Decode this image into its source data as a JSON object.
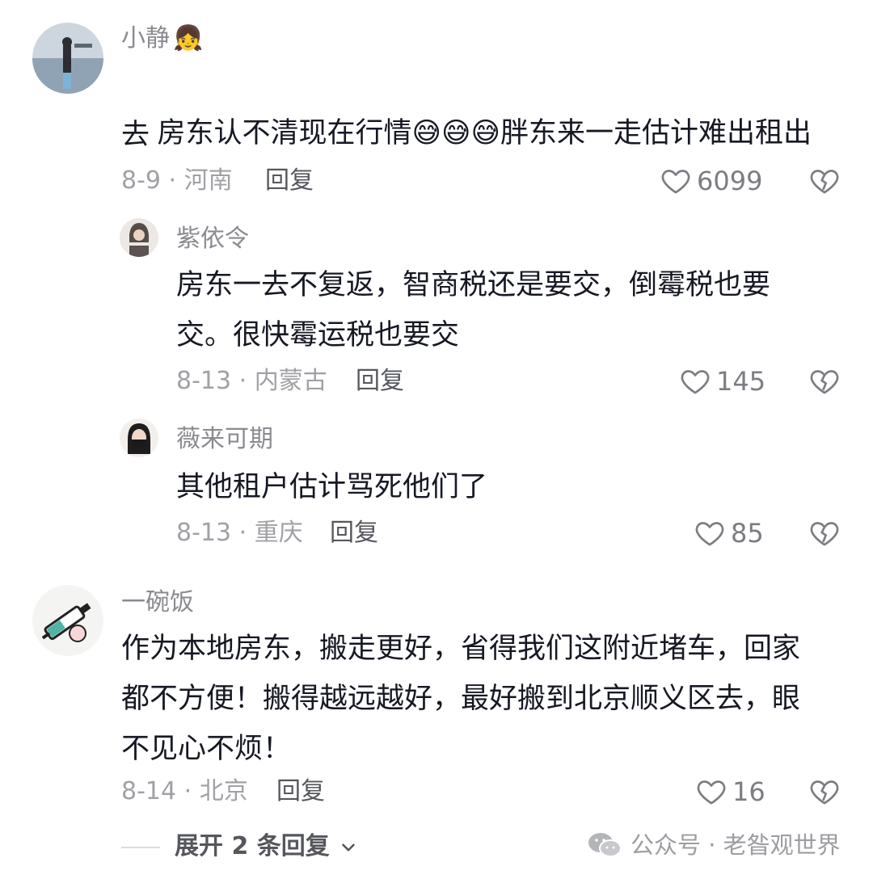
{
  "comments": [
    {
      "username": "小静",
      "username_emoji": "👧",
      "text_part1": "房东认不清现在行情",
      "inline_emojis": "😅😅😅",
      "text_part2": "胖东来一走估计难出租出",
      "text_line2": "去",
      "meta": "8-9 · 河南",
      "reply_label": "回复",
      "likes": "6099",
      "replies": [
        {
          "username": "紫依令",
          "text_line1": "房东一去不复返，智商税还是要交，倒霉税也要",
          "text_line2": "交。很快霉运税也要交",
          "meta": "8-13 · 内蒙古",
          "reply_label": "回复",
          "likes": "145"
        },
        {
          "username": "薇来可期",
          "text_line1": "其他租户估计骂死他们了",
          "meta": "8-13 · 重庆",
          "reply_label": "回复",
          "likes": "85"
        }
      ]
    },
    {
      "username": "一碗饭",
      "text_line1": "作为本地房东，搬走更好，省得我们这附近堵车，回家",
      "text_line2": "都不方便！搬得越远越好，最好搬到北京顺义区去，眼",
      "text_line3": "不见心不烦！",
      "meta": "8-14 · 北京",
      "reply_label": "回复",
      "likes": "16",
      "expand_label": "展开 2 条回复"
    }
  ],
  "watermark": "公众号 · 老昝观世界",
  "icons": {
    "like": "heart-outline-icon",
    "dislike": "broken-heart-icon",
    "expand": "chevron-down-icon",
    "watermark": "wechat-icon"
  },
  "colors": {
    "text": "#161823",
    "username": "#8a8b91",
    "meta": "#a0a1a6",
    "reply": "#56575d",
    "icon": "#7c7d83"
  }
}
